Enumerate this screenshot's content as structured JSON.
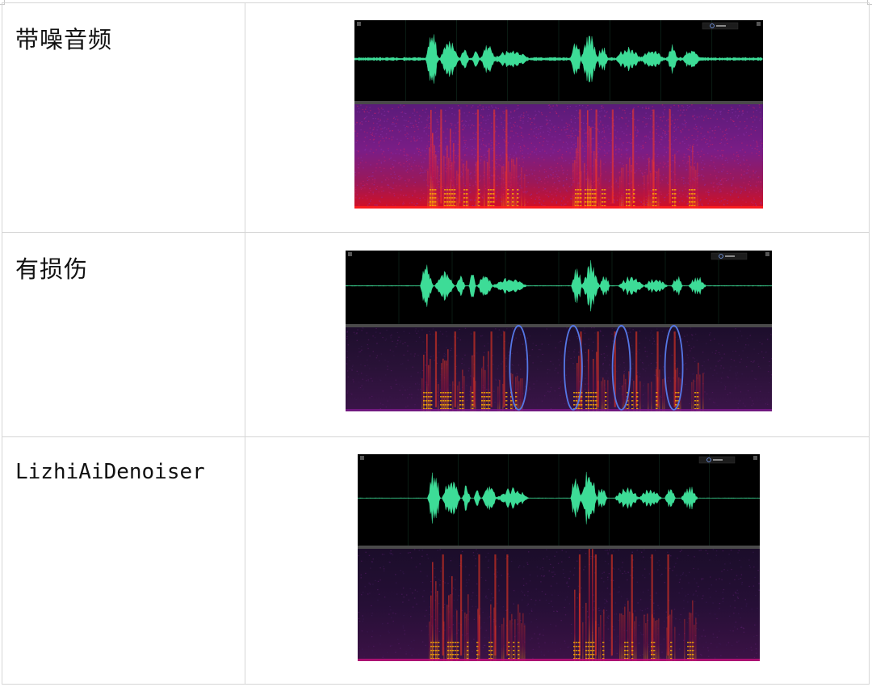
{
  "rows": [
    {
      "label": "带噪音频",
      "view": {
        "image": "noisy-audio-waveform-and-spectrogram",
        "spectrogram_palette": "magenta-red-heavy-noise",
        "meter_readout": "",
        "has_damage_markers": false
      }
    },
    {
      "label": "有损伤",
      "view": {
        "image": "damaged-audio-waveform-and-spectrogram",
        "spectrogram_palette": "dark-purple-low-noise",
        "meter_readout": "",
        "has_damage_markers": true,
        "marker_color": "#5577e6",
        "marker_count": 4
      }
    },
    {
      "label": "LizhiAiDenoiser",
      "view": {
        "image": "denoised-audio-waveform-and-spectrogram",
        "spectrogram_palette": "dark-purple-clean",
        "meter_readout": "",
        "has_damage_markers": false
      }
    }
  ],
  "colors": {
    "waveform": "#3ddc97",
    "waveform_bg": "#000000",
    "divider": "#4a4a4a",
    "table_border": "#d6d6d6",
    "label_text": "#111111"
  }
}
